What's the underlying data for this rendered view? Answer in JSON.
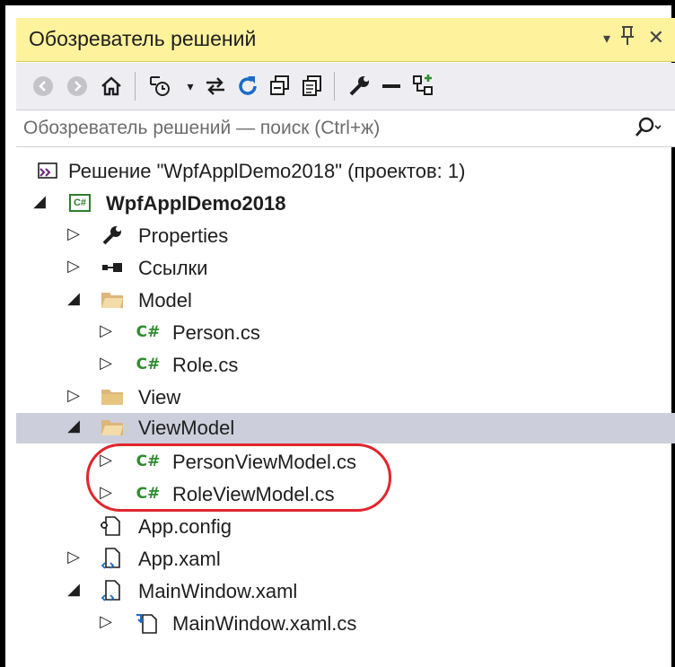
{
  "panel": {
    "title": "Обозреватель решений",
    "dropdown_glyph": "▾",
    "pin_glyph": "ꟼ",
    "close_glyph": "✕"
  },
  "search": {
    "placeholder": "Обозреватель решений — поиск (Ctrl+ж)"
  },
  "tree": {
    "solution": "Решение \"WpfApplDemo2018\"  (проектов: 1)",
    "project": "WpfApplDemo2018",
    "items": [
      {
        "label": "Properties"
      },
      {
        "label": "Ссылки"
      },
      {
        "label": "Model"
      },
      {
        "label": "Person.cs"
      },
      {
        "label": "Role.cs"
      },
      {
        "label": "View"
      },
      {
        "label": "ViewModel"
      },
      {
        "label": "PersonViewModel.cs"
      },
      {
        "label": "RoleViewModel.cs"
      },
      {
        "label": "App.config"
      },
      {
        "label": "App.xaml"
      },
      {
        "label": "MainWindow.xaml"
      },
      {
        "label": "MainWindow.xaml.cs"
      }
    ]
  },
  "icons": {
    "cs_badge": "C#",
    "csproj_badge": "C#"
  },
  "colors": {
    "title_bg": "#fff29d",
    "toolbar_bg": "#eeeef2",
    "selected_row": "#cccedb",
    "cs_green": "#2e8b2e",
    "highlight_red": "#e0262e",
    "folder_yellow": "#dcb67a"
  }
}
